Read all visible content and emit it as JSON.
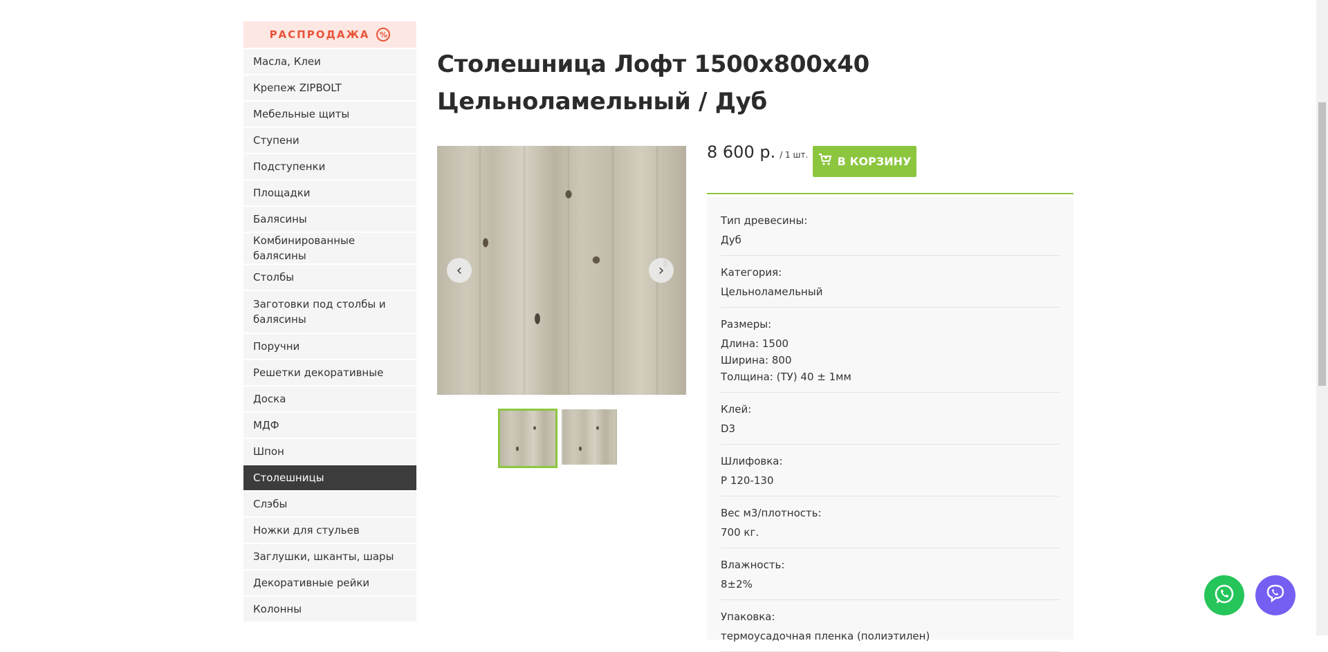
{
  "sidebar": {
    "sale_label": "РАСПРОДАЖА",
    "sale_icon": "%",
    "items": [
      "Масла, Клеи",
      "Крепеж ZIPBOLT",
      "Мебельные щиты",
      "Ступени",
      "Подступенки",
      "Площадки",
      "Балясины",
      "Комбинированные балясины",
      "Столбы",
      "Заготовки под столбы и балясины",
      "Поручни",
      "Решетки декоративные",
      "Доска",
      "МДФ",
      "Шпон",
      "Столешницы",
      "Слэбы",
      "Ножки для стульев",
      "Заглушки, шканты, шары",
      "Декоративные рейки",
      "Колонны"
    ],
    "active_item": "Столешницы"
  },
  "product": {
    "title": "Столешница Лофт 1500x800x40 Цельноламельный / Дуб",
    "price": "8 600 р.",
    "unit": "/ 1 шт.",
    "cart_label": "В КОРЗИНУ",
    "gallery": {
      "prev_icon": "‹",
      "next_icon": "›"
    },
    "properties": [
      {
        "label": "Тип древесины:",
        "value": "Дуб"
      },
      {
        "label": "Категория:",
        "value": "Цельноламельный"
      },
      {
        "label": "Размеры:",
        "value": "Длина: 1500\nШирина: 800\nТолщина: (ТУ) 40 ± 1мм"
      },
      {
        "label": "Клей:",
        "value": "D3"
      },
      {
        "label": "Шлифовка:",
        "value": "P 120-130"
      },
      {
        "label": "Вес м3/плотность:",
        "value": "700 кг."
      },
      {
        "label": "Влажность:",
        "value": "8±2%"
      },
      {
        "label": "Упаковка:",
        "value": "термоусадочная пленка (полиэтилен)"
      }
    ]
  },
  "colors": {
    "accent": "#8cc63f",
    "sale": "#e8553b",
    "active_menu": "#3c3c3c",
    "whatsapp": "#25c55a",
    "viber": "#7360f2"
  }
}
